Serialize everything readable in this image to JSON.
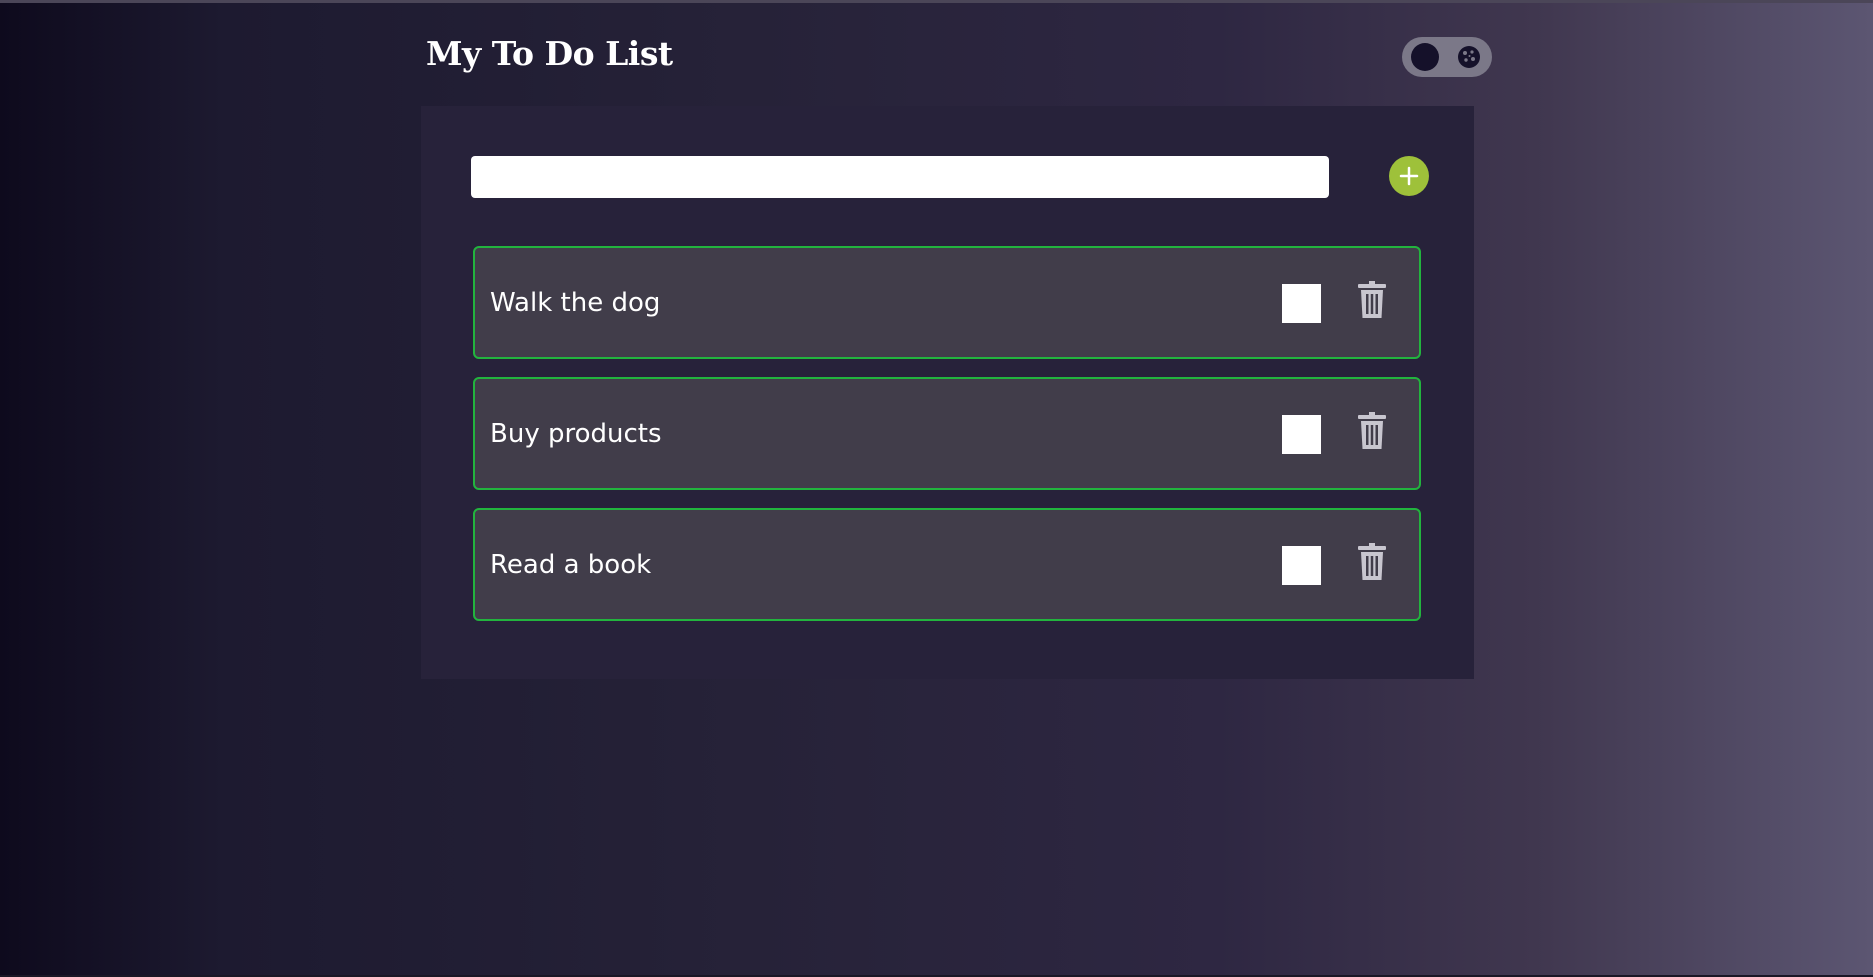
{
  "header": {
    "title": "My To Do List"
  },
  "theme_toggle": {
    "knob_icon": "moon-dark-circle",
    "side_icon": "cookie-icon"
  },
  "task_input": {
    "value": "",
    "placeholder": ""
  },
  "add_button": {
    "icon": "plus-icon",
    "color": "#9ec13a"
  },
  "tasks": [
    {
      "label": "Walk the dog",
      "completed": false
    },
    {
      "label": "Buy products",
      "completed": false
    },
    {
      "label": "Read a book",
      "completed": false
    }
  ],
  "colors": {
    "task_border": "#22b43e",
    "task_background": "#413d4a",
    "panel_background": "#27223a"
  }
}
